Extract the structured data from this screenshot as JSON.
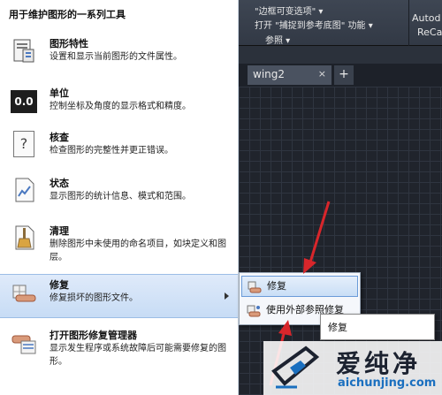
{
  "menu": {
    "header": "用于维护图形的一系列工具",
    "items": [
      {
        "title": "图形特性",
        "desc": "设置和显示当前图形的文件属性。",
        "icon": "drawing-properties-icon"
      },
      {
        "title": "单位",
        "desc": "控制坐标及角度的显示格式和精度。",
        "icon": "units-icon",
        "icon_text": "0.0"
      },
      {
        "title": "核查",
        "desc": "检查图形的完整性并更正错误。",
        "icon": "audit-icon",
        "icon_text": "?"
      },
      {
        "title": "状态",
        "desc": "显示图形的统计信息、模式和范围。",
        "icon": "status-icon"
      },
      {
        "title": "清理",
        "desc": "删除图形中未使用的命名项目，如块定义和图层。",
        "icon": "purge-icon"
      },
      {
        "title": "修复",
        "desc": "修复损坏的图形文件。",
        "icon": "recover-icon",
        "active": true
      },
      {
        "title": "打开图形修复管理器",
        "desc": "显示发生程序或系统故障后可能需要修复的图形。",
        "icon": "recovery-manager-icon"
      }
    ]
  },
  "ribbon": {
    "line1": "\"边框可变选项\" ▾",
    "line2": "打开 \"捕捉到参考底图\" 功能 ▾",
    "line3": "参照 ▾",
    "autodesk_line1": "Autod",
    "autodesk_line2": "ReCa"
  },
  "tabs": {
    "doc_tab": "wing2",
    "close": "×",
    "new_tab": "+"
  },
  "submenu": {
    "items": [
      {
        "label": "修复",
        "icon": "recover-small-icon"
      },
      {
        "label": "使用外部参照修复",
        "icon": "recover-xref-icon"
      }
    ]
  },
  "tooltip": {
    "text": "修复"
  },
  "watermark": {
    "cn": "爱纯净",
    "url": "aichunjing.com"
  },
  "colors": {
    "accent_red": "#d8262b",
    "menu_active": "#c7dcf5",
    "canvas_bg": "#20242c"
  }
}
